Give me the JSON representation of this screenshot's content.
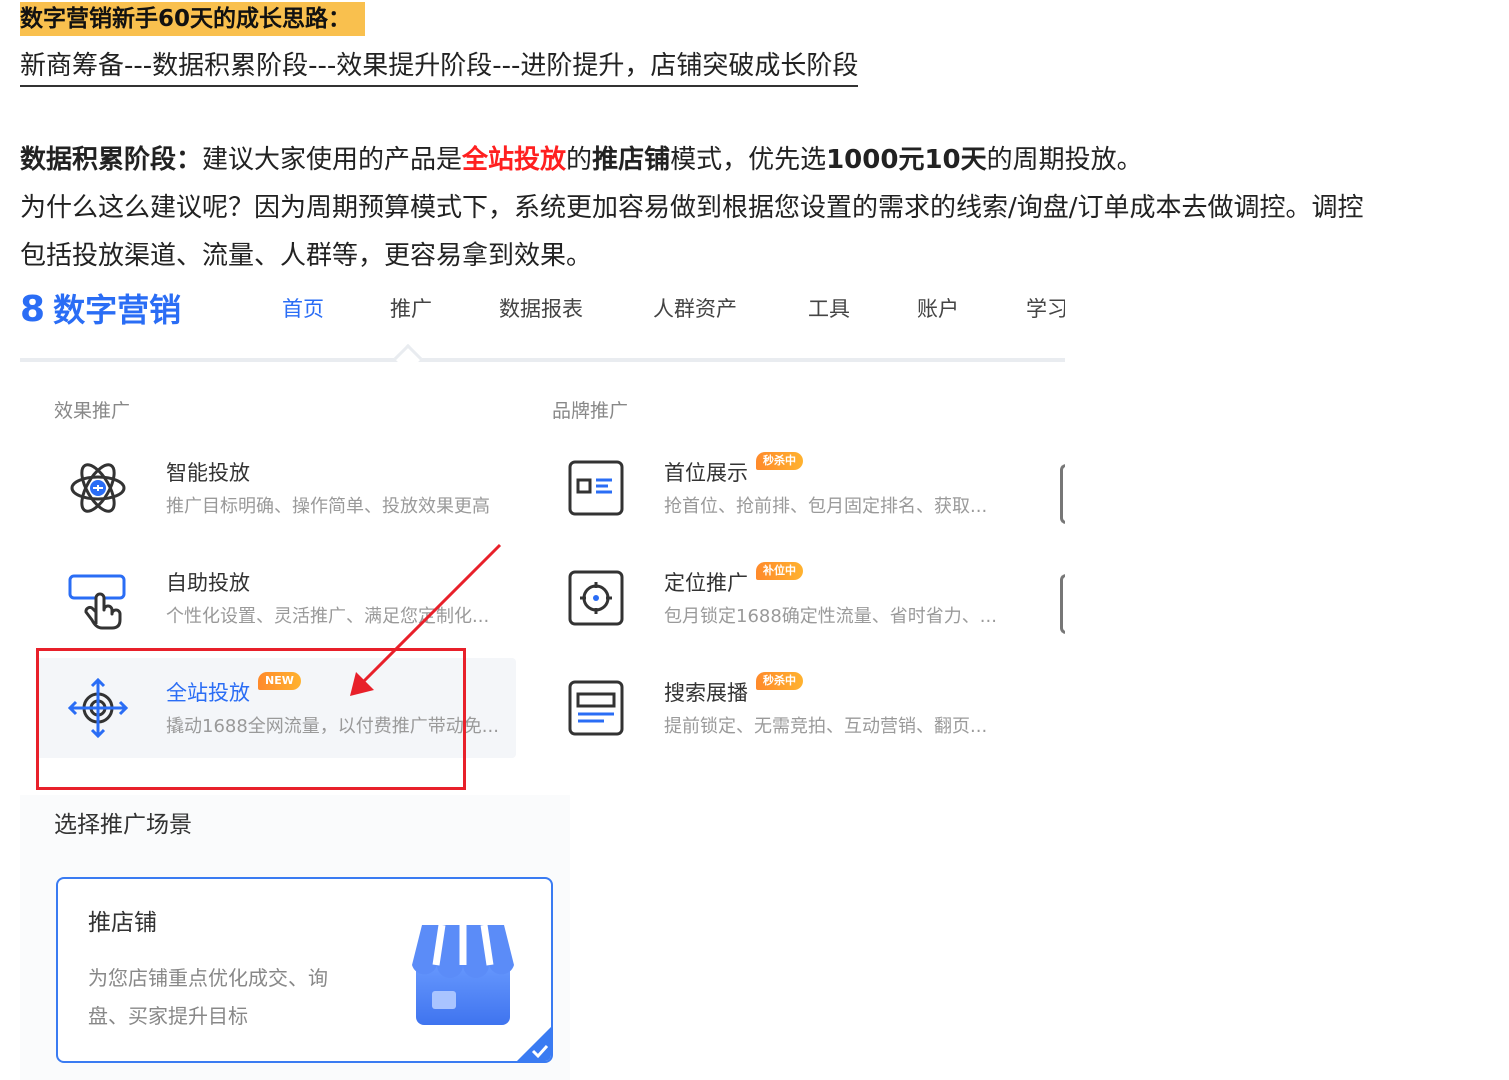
{
  "article": {
    "heading": "数字营销新手60天的成长思路：",
    "stages": "新商筹备---数据积累阶段---效果提升阶段---进阶提升，店铺突破成长阶段",
    "p1_lead": "数据积累阶段：",
    "p1_a": "建议大家使用的产品是",
    "p1_product": "全站投放",
    "p1_b": "的",
    "p1_mode": "推店铺",
    "p1_c": "模式，优先选",
    "p1_budget": "1000元10天",
    "p1_d": "的周期投放。",
    "p2": "为什么这么建议呢？因为周期预算模式下，系统更加容易做到根据您设置的需求的线索/询盘/订单成本去做调控。调控",
    "p3": "包括投放渠道、流量、人群等，更容易拿到效果。"
  },
  "nav": {
    "logo_mark": "8",
    "logo_text": "数字营销",
    "items": [
      {
        "label": "首页"
      },
      {
        "label": "推广"
      },
      {
        "label": "数据报表"
      },
      {
        "label": "人群资产"
      },
      {
        "label": "工具"
      },
      {
        "label": "账户"
      },
      {
        "label": "学习"
      }
    ]
  },
  "dropdown": {
    "group_effect": "效果推广",
    "group_brand": "品牌推广",
    "effect_items": [
      {
        "title": "智能投放",
        "desc": "推广目标明确、操作简单、投放效果更高",
        "icon": "atom-icon"
      },
      {
        "title": "自助投放",
        "desc": "个性化设置、灵活推广、满足您定制化...",
        "icon": "hand-click-icon"
      },
      {
        "title": "全站投放",
        "desc": "撬动1688全网流量，以付费推广带动免...",
        "badge": "NEW",
        "icon": "target-arrows-icon"
      }
    ],
    "brand_items": [
      {
        "title": "首位展示",
        "desc": "抢首位、抢前排、包月固定排名、获取...",
        "badge": "秒杀中",
        "icon": "card-list-icon"
      },
      {
        "title": "定位推广",
        "desc": "包月锁定1688确定性流量、省时省力、...",
        "badge": "补位中",
        "icon": "crosshair-icon"
      },
      {
        "title": "搜索展播",
        "desc": "提前锁定、无需竞拍、互动营销、翻页...",
        "badge": "秒杀中",
        "icon": "banner-icon"
      }
    ]
  },
  "scene": {
    "title": "选择推广场景",
    "card_name": "推店铺",
    "card_desc": "为您店铺重点优化成交、询盘、买家提升目标"
  },
  "colors": {
    "accent": "#2a6df5",
    "highlight": "#f9c04e",
    "annotation_red": "#e8202a",
    "badge_orange": "#ff8a2b"
  }
}
